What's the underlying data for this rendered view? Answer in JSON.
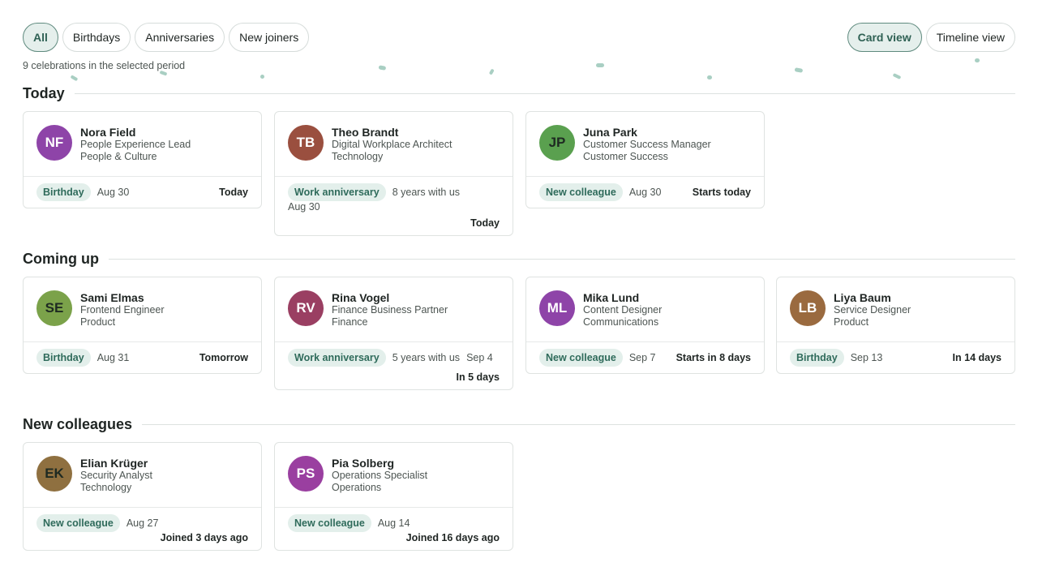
{
  "filters": [
    {
      "label": "All",
      "active": true
    },
    {
      "label": "Birthdays",
      "active": false
    },
    {
      "label": "Anniversaries",
      "active": false
    },
    {
      "label": "New joiners",
      "active": false
    }
  ],
  "views": [
    {
      "label": "Card view",
      "active": true
    },
    {
      "label": "Timeline view",
      "active": false
    }
  ],
  "summary": "9 celebrations in the selected period",
  "colors": {
    "accent": "#2f6154",
    "tag_bg": "#e3efeb",
    "confetti": "#9fc9bc"
  },
  "sections": [
    {
      "title": "Today",
      "cards": [
        {
          "initials": "NF",
          "avatar_color": "#8e44a8",
          "name": "Nora Field",
          "role": "People Experience Lead",
          "dept": "People & Culture",
          "tag": "Birthday",
          "meta": "",
          "date": "Aug 30",
          "relative": "Today"
        },
        {
          "initials": "TB",
          "avatar_color": "#9a4f3f",
          "name": "Theo Brandt",
          "role": "Digital Workplace Architect",
          "dept": "Technology",
          "tag": "Work anniversary",
          "meta": "8 years with us",
          "date": "Aug 30",
          "relative": "Today"
        },
        {
          "initials": "JP",
          "avatar_color": "#5aa04f",
          "name": "Juna Park",
          "role": "Customer Success Manager",
          "dept": "Customer Success",
          "tag": "New colleague",
          "meta": "",
          "date": "Aug 30",
          "relative": "Starts today"
        }
      ]
    },
    {
      "title": "Coming up",
      "cards": [
        {
          "initials": "SE",
          "avatar_color": "#7ba24a",
          "name": "Sami Elmas",
          "role": "Frontend Engineer",
          "dept": "Product",
          "tag": "Birthday",
          "meta": "",
          "date": "Aug 31",
          "relative": "Tomorrow"
        },
        {
          "initials": "RV",
          "avatar_color": "#9a3f62",
          "name": "Rina Vogel",
          "role": "Finance Business Partner",
          "dept": "Finance",
          "tag": "Work anniversary",
          "meta": "5 years with us",
          "date": "Sep 4",
          "relative": "In 5 days"
        },
        {
          "initials": "ML",
          "avatar_color": "#8e44a8",
          "name": "Mika Lund",
          "role": "Content Designer",
          "dept": "Communications",
          "tag": "New colleague",
          "meta": "",
          "date": "Sep 7",
          "relative": "Starts in 8 days"
        },
        {
          "initials": "LB",
          "avatar_color": "#9a6a3f",
          "name": "Liya Baum",
          "role": "Service Designer",
          "dept": "Product",
          "tag": "Birthday",
          "meta": "",
          "date": "Sep 13",
          "relative": "In 14 days"
        }
      ]
    },
    {
      "title": "New colleagues",
      "cards": [
        {
          "initials": "EK",
          "avatar_color": "#8f7040",
          "name": "Elian Krüger",
          "role": "Security Analyst",
          "dept": "Technology",
          "tag": "New colleague",
          "meta": "",
          "date": "Aug 27",
          "relative": "Joined 3 days ago"
        },
        {
          "initials": "PS",
          "avatar_color": "#9a3fa0",
          "name": "Pia Solberg",
          "role": "Operations Specialist",
          "dept": "Operations",
          "tag": "New colleague",
          "meta": "",
          "date": "Aug 14",
          "relative": "Joined 16 days ago"
        }
      ]
    }
  ]
}
